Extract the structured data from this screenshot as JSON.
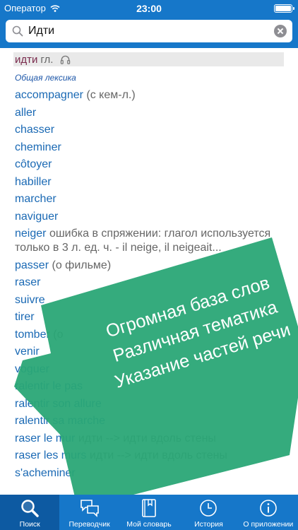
{
  "status_bar": {
    "carrier": "Оператор",
    "time": "23:00"
  },
  "search": {
    "value": "Идти",
    "placeholder": ""
  },
  "headword": {
    "word": "идти",
    "pos": "гл."
  },
  "category": "Общая лексика",
  "entries": [
    {
      "fr": "accompagner",
      "note": "(с кем-л.)"
    },
    {
      "fr": "aller",
      "note": ""
    },
    {
      "fr": "chasser",
      "note": ""
    },
    {
      "fr": "cheminer",
      "note": ""
    },
    {
      "fr": "côtoyer",
      "note": ""
    },
    {
      "fr": "habiller",
      "note": ""
    },
    {
      "fr": "marcher",
      "note": ""
    },
    {
      "fr": "naviguer",
      "note": ""
    },
    {
      "fr": "neiger",
      "note": "ошибка в спряжении: глагол используется только в 3 л. ед. ч. - il neige, il neigeait..."
    },
    {
      "fr": "passer",
      "note": "(о фильме)"
    },
    {
      "fr": "raser",
      "note": ""
    },
    {
      "fr": "suivre",
      "note": ""
    },
    {
      "fr": "tirer",
      "note": ""
    },
    {
      "fr": "tomber",
      "note": "(о"
    },
    {
      "fr": "venir",
      "note": ""
    },
    {
      "fr": "voguer",
      "note": ""
    },
    {
      "fr": "ralentir le pas",
      "note": ""
    },
    {
      "fr": "ralentir son allure",
      "note": ""
    },
    {
      "fr": "ralentir sa marche",
      "note": ""
    },
    {
      "fr": "raser le mur",
      "note": "идти --> идти вдоль стены"
    },
    {
      "fr": "raser les murs",
      "note": "идти --> идти вдоль стены"
    },
    {
      "fr": "s'acheminer",
      "note": ""
    }
  ],
  "promo": {
    "lines": [
      "Огромная база слов",
      "Различная тематика",
      "Указание частей речи"
    ],
    "color": "#2aa776"
  },
  "tabs": [
    {
      "label": "Поиск",
      "icon": "search-icon",
      "active": true
    },
    {
      "label": "Переводчик",
      "icon": "chat-bubbles-icon",
      "active": false
    },
    {
      "label": "Мой словарь",
      "icon": "book-icon",
      "active": false
    },
    {
      "label": "История",
      "icon": "clock-icon",
      "active": false
    },
    {
      "label": "О приложении",
      "icon": "info-icon",
      "active": false
    }
  ],
  "colors": {
    "bar": "#1677c9",
    "active_tab": "#0d5aa2",
    "link": "#1a69b4",
    "headword": "#7a2b4d"
  }
}
